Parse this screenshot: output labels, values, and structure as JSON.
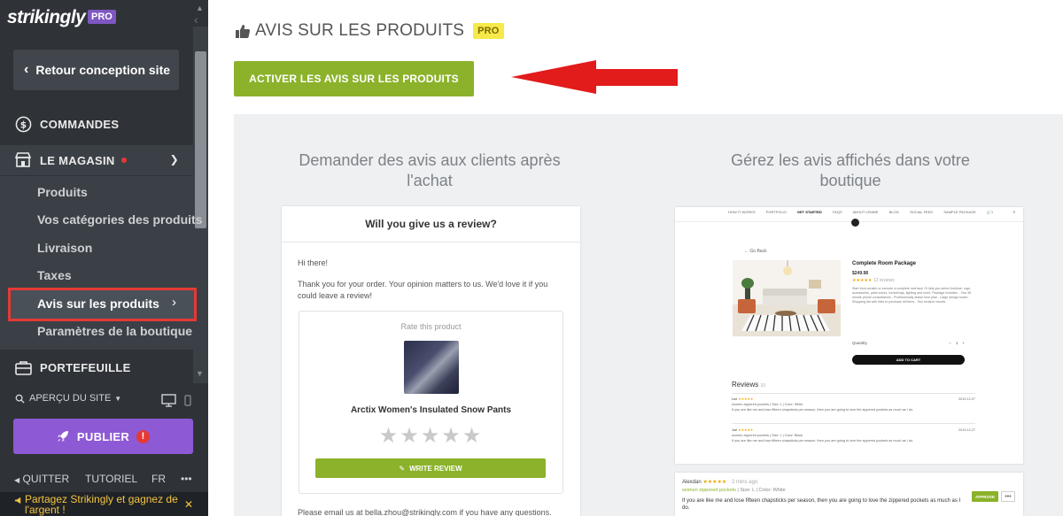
{
  "sidebar": {
    "brand": "strikingly",
    "brand_badge": "PRO",
    "back_label": "Retour conception site",
    "commandes_label": "COMMANDES",
    "magasin_label": "LE MAGASIN",
    "store_items": [
      {
        "label": "Produits"
      },
      {
        "label": "Vos catégories des produits"
      },
      {
        "label": "Livraison"
      },
      {
        "label": "Taxes"
      },
      {
        "label": "Avis sur les produits"
      },
      {
        "label": "Paramètres de la boutique"
      }
    ],
    "portefeuille_label": "PORTEFEUILLE",
    "apercu_label": "APERÇU DU SITE",
    "publish_label": "PUBLIER",
    "quit_label": "QUITTER",
    "tutorial_label": "TUTORIEL",
    "lang_label": "FR",
    "more_label": "•••",
    "promo_text": "Partagez Strikingly et gagnez de l'argent !"
  },
  "main": {
    "title": "AVIS SUR LES PRODUITS",
    "title_badge": "PRO",
    "activate_label": "ACTIVER LES AVIS SUR LES PRODUITS",
    "left_heading": "Demander des avis aux clients après l'achat",
    "right_heading": "Gérez les avis affichés dans votre boutique"
  },
  "email": {
    "header": "Will you give us a review?",
    "greeting": "Hi there!",
    "body": "Thank you for your order. Your opinion matters to us. We'd love it if you could leave a review!",
    "rate_label": "Rate this product",
    "product_name": "Arctix Women's Insulated Snow Pants",
    "stars": "★★★★★",
    "write_review_label": "WRITE REVIEW",
    "footer": "Please email us at bella.zhou@strikingly.com if you have any questions."
  },
  "preview": {
    "nav": [
      "HOW IT WORKS",
      "PORTFOLIO",
      "GET STARTED",
      "FAQS",
      "ABOUT LEMME",
      "BLOG",
      "SOCIAL FEED",
      "SAMPLE PACKAGE"
    ],
    "back": "← Go Back",
    "product_title": "Complete Room Package",
    "price": "$249.98",
    "rating_stars": "★★★★★",
    "rating_count": "12 reviews",
    "description": "Start from scratch or execute a complete overhaul. I'll help you select furniture, rugs, accessories, paint colors, furnishings, lighting and more. Package includes: - Two 45 minute phone consultations - Professionally drawn floor plan - Large design board - Shopping list with links to purchase all items - Two revision rounds",
    "quantity_label": "Quantity",
    "quantity_value": "1",
    "cart_label": "ADD TO CART",
    "reviews_label": "Reviews",
    "reviews_count": "10",
    "reviews": [
      {
        "name": "Lee",
        "stars": "★★★★★",
        "meta": "women zippered pockets  |  Size: L  |  Color: White",
        "date": "2019.12.27",
        "text": "If you are like me and lose fifteen chapsticks per season, then you are going to love the zippered pockets as much as I do."
      },
      {
        "name": "Joe",
        "stars": "★★★★★",
        "meta": "women zippered pockets  |  Size: L  |  Color: Black",
        "date": "2019.12.27",
        "text": "If you are like me and lose fifteen chapsticks per season, then you are going to love the zippered pockets as much as I do."
      }
    ]
  },
  "admin_review": {
    "name": "Alexdan",
    "stars": "★★★★★",
    "time": "2 mins ago",
    "product": "women zippered pockets",
    "meta": "|  Size: L  |  Color: White",
    "text": "If you are like me and lose fifteen chapsticks per season, then you are going to love the zippered pockets as much as I do.",
    "approve_label": "APPROVE",
    "more_label": "•••"
  },
  "colors": {
    "sidebar_bg": "#2f3338",
    "accent_green": "#8bb22a",
    "publish_purple": "#8e59d4",
    "highlight_red": "#e53935",
    "pro_yellow": "#f7e94a"
  },
  "icons": [
    "chevron-left-icon",
    "dollar-icon",
    "store-icon",
    "chevron-down-icon",
    "chevron-right-icon",
    "briefcase-icon",
    "search-icon",
    "monitor-icon",
    "phone-icon",
    "rocket-icon",
    "thumbs-up-icon",
    "pencil-icon",
    "arrow-annotation"
  ]
}
